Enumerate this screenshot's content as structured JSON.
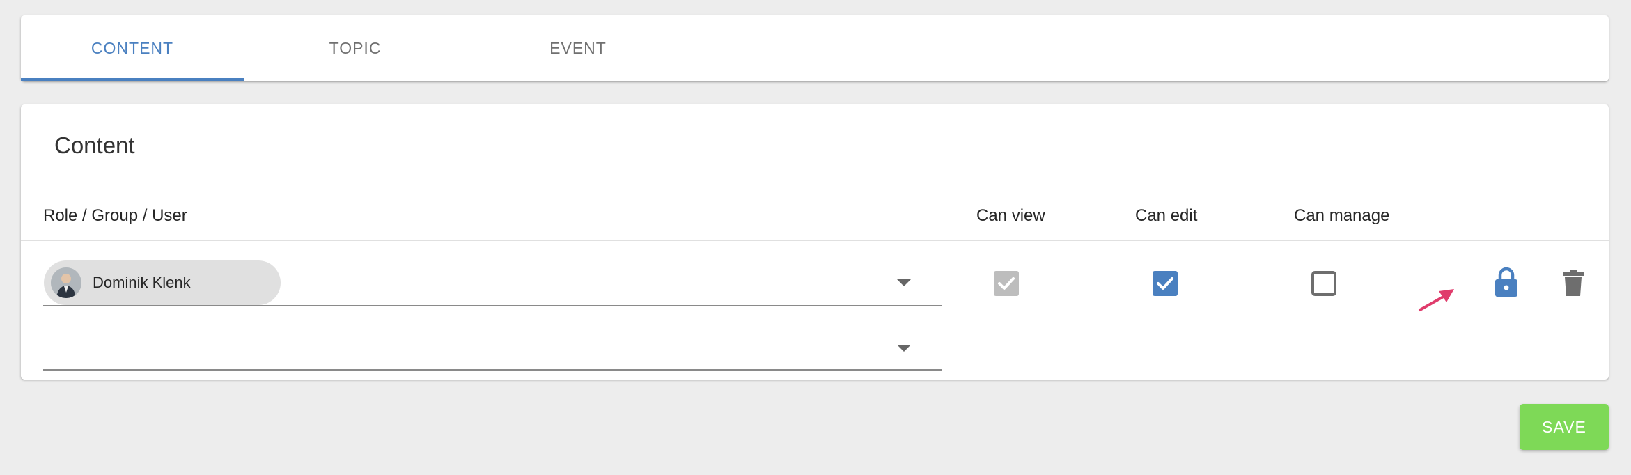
{
  "tabs": [
    {
      "label": "CONTENT",
      "active": true
    },
    {
      "label": "TOPIC",
      "active": false
    },
    {
      "label": "EVENT",
      "active": false
    }
  ],
  "section": {
    "title": "Content"
  },
  "columns": {
    "role": "Role / Group / User",
    "can_view": "Can view",
    "can_edit": "Can edit",
    "can_manage": "Can manage"
  },
  "rows": [
    {
      "user_chip": "Dominik Klenk",
      "can_view": {
        "checked": true,
        "disabled": true
      },
      "can_edit": {
        "checked": true,
        "disabled": false
      },
      "can_manage": {
        "checked": false,
        "disabled": false
      },
      "lock_icon": "lock-icon",
      "delete_icon": "trash-icon"
    },
    {
      "user_chip": "",
      "empty": true
    }
  ],
  "actions": {
    "save_label": "SAVE"
  },
  "colors": {
    "accent": "#4a80c0",
    "save": "#7ed957",
    "annotation_arrow": "#e03c6c",
    "disabled_checkbox": "#bdbdbd"
  }
}
